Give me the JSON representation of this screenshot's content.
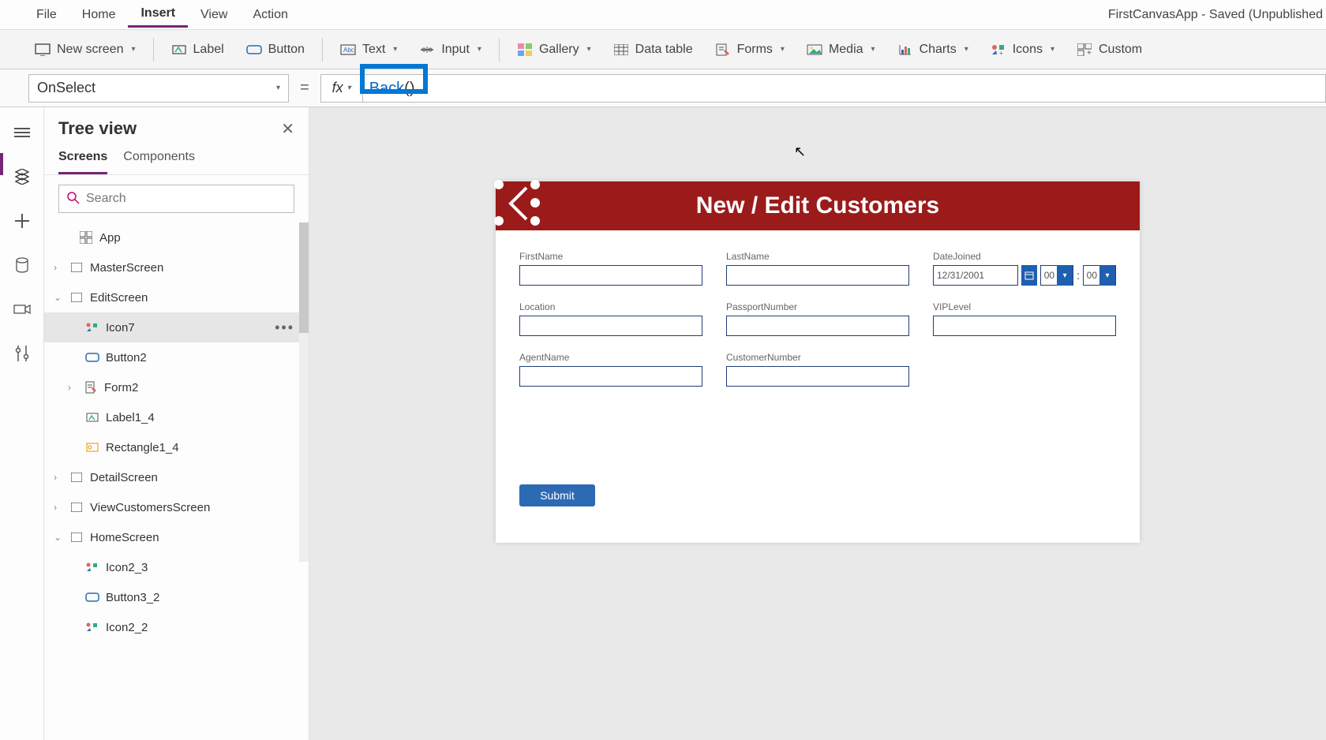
{
  "menu": {
    "file": "File",
    "home": "Home",
    "insert": "Insert",
    "view": "View",
    "action": "Action"
  },
  "app_title": "FirstCanvasApp - Saved (Unpublished",
  "ribbon": {
    "new_screen": "New screen",
    "label": "Label",
    "button": "Button",
    "text": "Text",
    "input": "Input",
    "gallery": "Gallery",
    "data_table": "Data table",
    "forms": "Forms",
    "media": "Media",
    "charts": "Charts",
    "icons": "Icons",
    "custom": "Custom"
  },
  "formula": {
    "property": "OnSelect",
    "eq": "=",
    "fx": "fx",
    "fn": "Back",
    "parens": "()"
  },
  "tree": {
    "title": "Tree view",
    "tab_screens": "Screens",
    "tab_components": "Components",
    "search_placeholder": "Search",
    "app": "App",
    "items": {
      "master": "MasterScreen",
      "edit": "EditScreen",
      "icon7": "Icon7",
      "button2": "Button2",
      "form2": "Form2",
      "label1_4": "Label1_4",
      "rect1_4": "Rectangle1_4",
      "detail": "DetailScreen",
      "viewcust": "ViewCustomersScreen",
      "home": "HomeScreen",
      "icon2_3": "Icon2_3",
      "button3_2": "Button3_2",
      "icon2_2": "Icon2_2"
    }
  },
  "canvas": {
    "header": "New / Edit Customers",
    "fields": {
      "firstname": "FirstName",
      "lastname": "LastName",
      "datejoined": "DateJoined",
      "datevalue": "12/31/2001",
      "hour": "00",
      "minute": "00",
      "timesep": ":",
      "location": "Location",
      "passport": "PassportNumber",
      "viplevel": "VIPLevel",
      "agentname": "AgentName",
      "customernumber": "CustomerNumber"
    },
    "submit": "Submit"
  }
}
